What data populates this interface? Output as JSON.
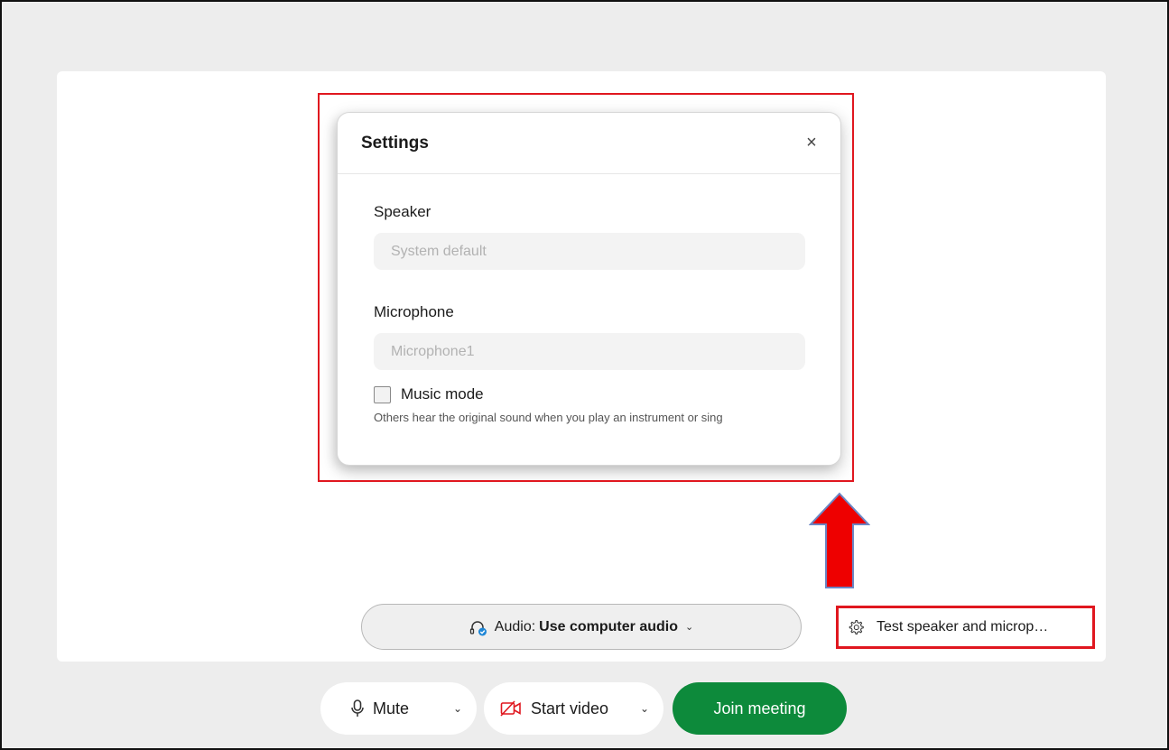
{
  "settings": {
    "title": "Settings",
    "close_glyph": "×",
    "speaker_label": "Speaker",
    "speaker_value": "System default",
    "microphone_label": "Microphone",
    "microphone_value": "Microphone1",
    "music_mode_label": "Music mode",
    "music_mode_checked": false,
    "music_mode_help": "Others hear the original sound when you play an instrument or sing"
  },
  "audio": {
    "prefix": "Audio:",
    "value": "Use computer audio",
    "chevron": "⌄",
    "icon": "headset-icon"
  },
  "test": {
    "label": "Test speaker and microp…",
    "icon": "gear-icon"
  },
  "controls": {
    "mute_label": "Mute",
    "mute_icon": "microphone-icon",
    "video_label": "Start video",
    "video_icon": "video-off-icon",
    "dropdown_glyph": "⌄",
    "join_label": "Join meeting"
  },
  "colors": {
    "join": "#0d8a3b",
    "highlight": "#e0171f",
    "video_icon": "#e0171f"
  }
}
